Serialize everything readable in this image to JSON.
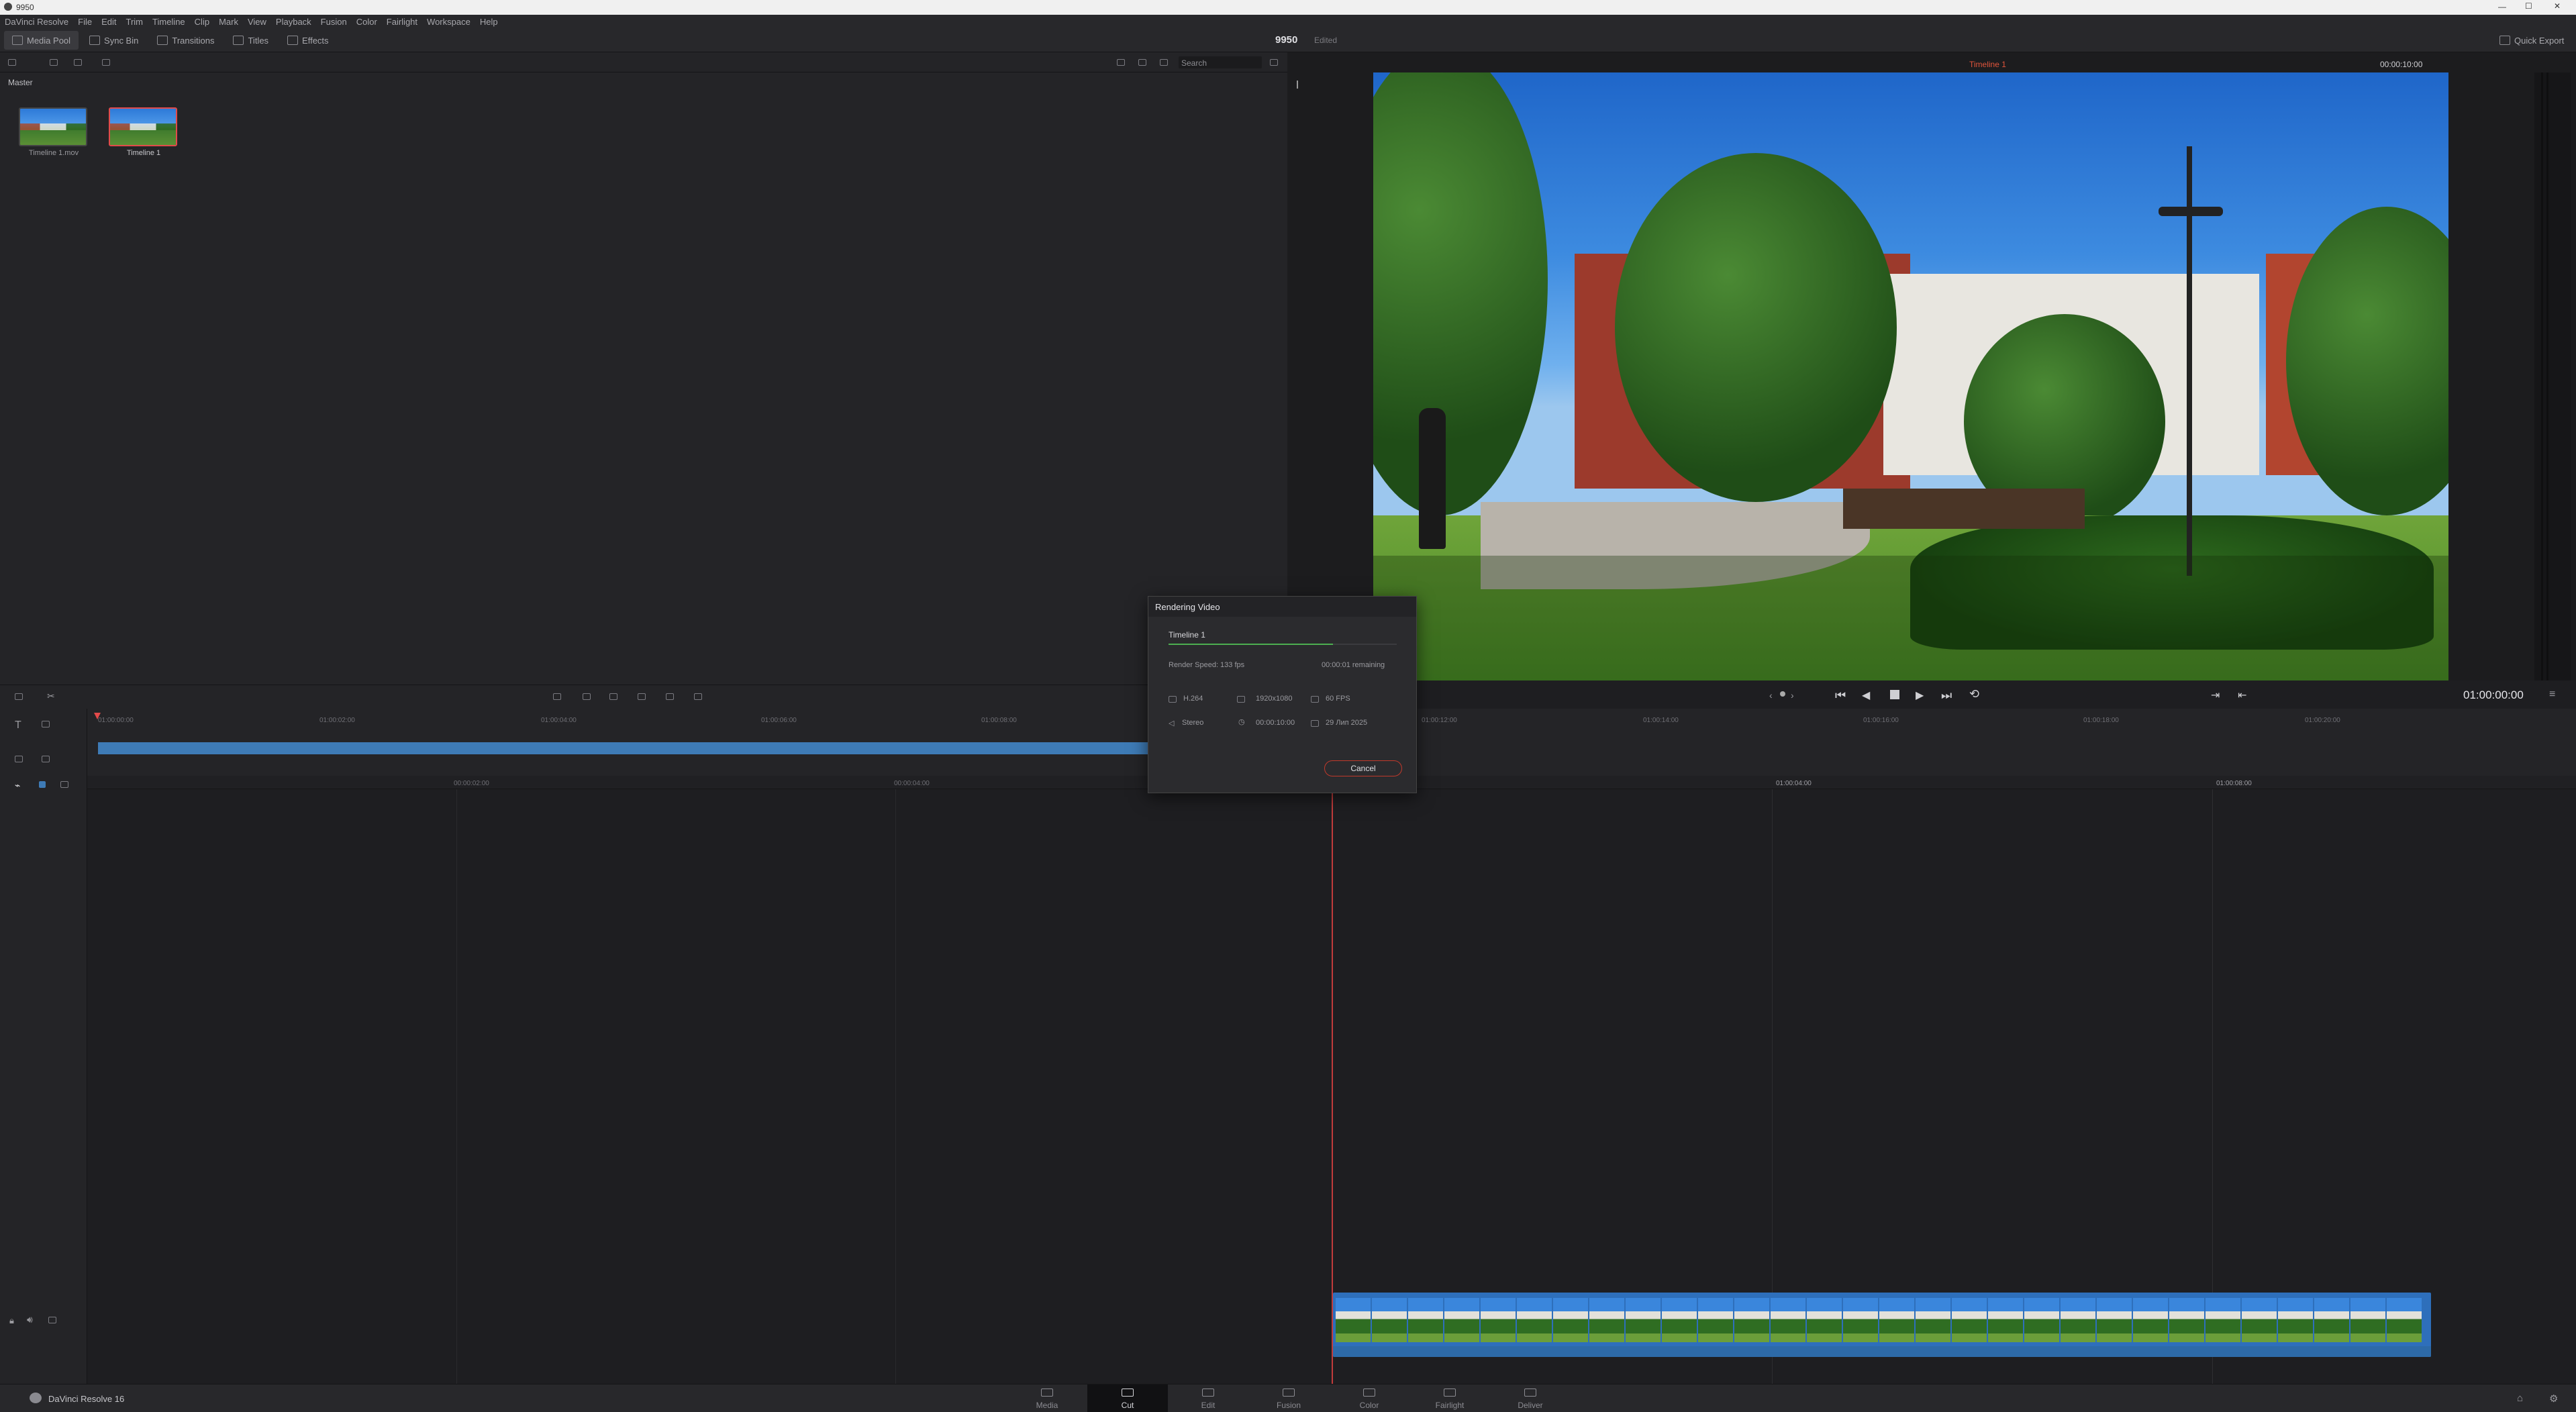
{
  "window": {
    "title": "9950"
  },
  "menu": {
    "items": [
      "DaVinci Resolve",
      "File",
      "Edit",
      "Trim",
      "Timeline",
      "Clip",
      "Mark",
      "View",
      "Playback",
      "Fusion",
      "Color",
      "Fairlight",
      "Workspace",
      "Help"
    ]
  },
  "toolbar": {
    "media_pool": "Media Pool",
    "sync_bin": "Sync Bin",
    "transitions": "Transitions",
    "titles": "Titles",
    "effects": "Effects",
    "project_name": "9950",
    "project_status": "Edited",
    "quick_export": "Quick Export"
  },
  "media_pool": {
    "search_placeholder": "Search",
    "bin_name": "Master",
    "clips": [
      {
        "name": "Timeline 1.mov",
        "selected": false
      },
      {
        "name": "Timeline 1",
        "selected": true
      }
    ]
  },
  "viewer": {
    "timeline_name": "Timeline 1",
    "duration": "00:00:10:00",
    "timecode": "01:00:00:00"
  },
  "upper_timeline": {
    "ruler": [
      "01:00:00:00",
      "01:00:02:00",
      "01:00:04:00",
      "01:00:06:00",
      "01:00:08:00"
    ],
    "ruler_right": [
      "01:00:12:00",
      "01:00:14:00",
      "01:00:16:00",
      "01:00:18:00",
      "01:00:20:00"
    ]
  },
  "lower_timeline": {
    "ruler": [
      "00:00:02:00",
      "00:00:04:00",
      "01:00:04:00",
      "01:00:08:00"
    ]
  },
  "render_dialog": {
    "title": "Rendering Video",
    "timeline": "Timeline 1",
    "progress": 0.72,
    "speed": "Render Speed: 133 fps",
    "remaining": "00:00:01 remaining",
    "codec": "H.264",
    "resolution": "1920x1080",
    "fps": "60 FPS",
    "audio": "Stereo",
    "duration": "00:00:10:00",
    "date": "29 Лип 2025",
    "cancel": "Cancel"
  },
  "bottom": {
    "app": "DaVinci Resolve 16",
    "pages": [
      "Media",
      "Cut",
      "Edit",
      "Fusion",
      "Color",
      "Fairlight",
      "Deliver"
    ],
    "active_page": "Cut"
  },
  "colors": {
    "accent_red": "#e24a4a",
    "clip_blue": "#3e7bb6",
    "bg": "#1e1e21"
  }
}
